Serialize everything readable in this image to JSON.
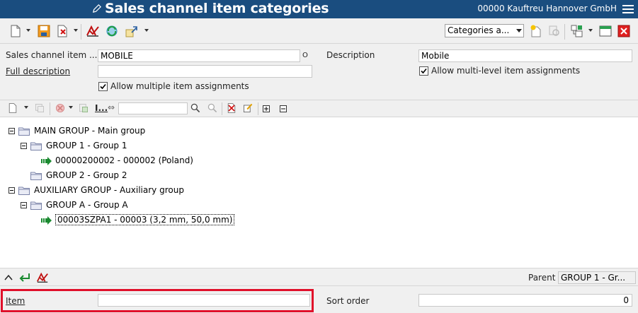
{
  "window": {
    "title": "Sales channel item categories",
    "company": "00000  Kauftreu Hannover GmbH"
  },
  "toolbar": {
    "view_select": "Categories a...",
    "icons": [
      "new-document-icon",
      "save-icon",
      "delete-icon",
      "check-icon",
      "refresh-icon",
      "export-icon",
      "add-category-icon",
      "search-record-icon",
      "settings-tree-icon",
      "window-icon",
      "close-icon"
    ]
  },
  "form": {
    "sales_channel_item_label": "Sales channel item ...",
    "sales_channel_item_value": "MOBILE",
    "sales_channel_item_suffix": "O",
    "description_label": "Description",
    "description_value": "Mobile",
    "full_description_label": "Full description",
    "full_description_value": "",
    "allow_multi_level_label": "Allow multi-level item assignments",
    "allow_multi_level_checked": true,
    "allow_multiple_label": "Allow multiple item assignments",
    "allow_multiple_checked": true
  },
  "tree_toolbar": {
    "filter_label": "I...",
    "filter_value": ""
  },
  "tree": {
    "nodes": [
      {
        "label": "MAIN GROUP - Main group",
        "type": "group",
        "expanded": true
      },
      {
        "label": "GROUP 1 - Group 1",
        "type": "group",
        "expanded": true
      },
      {
        "label": "00000200002 - 000002 (Poland)",
        "type": "item"
      },
      {
        "label": "GROUP 2 - Group 2",
        "type": "group",
        "expanded": false
      },
      {
        "label": "AUXILIARY GROUP - Auxiliary group",
        "type": "group",
        "expanded": true
      },
      {
        "label": "GROUP A - Group A",
        "type": "group",
        "expanded": true
      },
      {
        "label": "00003SZPA1 - 00003 (3,2 mm, 50,0 mm)",
        "type": "item",
        "selected": true
      }
    ]
  },
  "bottombar": {
    "parent_label": "Parent",
    "parent_value": "GROUP 1 - Gr..."
  },
  "detail": {
    "item_label": "Item",
    "item_value": "",
    "sort_order_label": "Sort order",
    "sort_order_value": "0"
  },
  "colors": {
    "titlebar": "#1a4d7f",
    "highlight": "#e0102a"
  }
}
